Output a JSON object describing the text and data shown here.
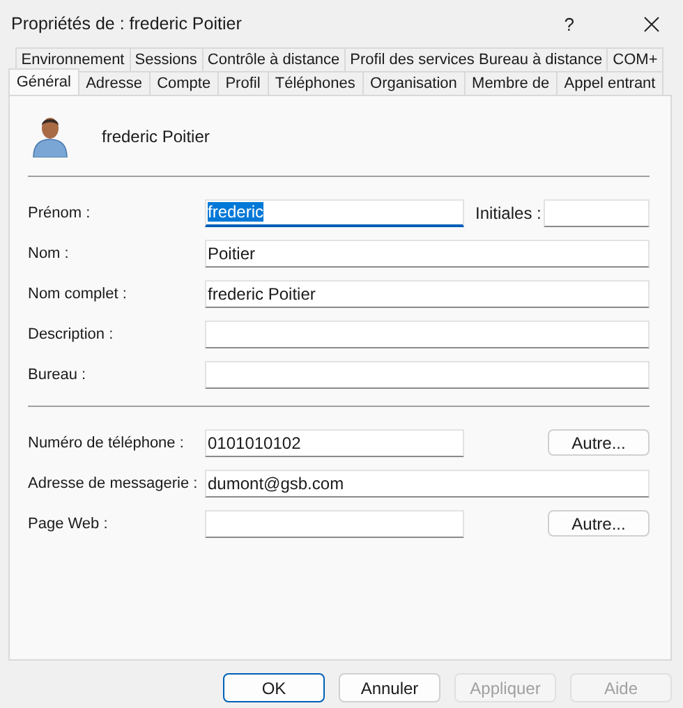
{
  "window": {
    "title": "Propriétés de : frederic Poitier",
    "help": "?"
  },
  "tab_rows": [
    {
      "tabs": [
        {
          "label": "Environnement",
          "selected": false
        },
        {
          "label": "Sessions",
          "selected": false
        },
        {
          "label": "Contrôle à distance",
          "selected": false
        },
        {
          "label": "Profil des services Bureau à distance",
          "selected": false
        },
        {
          "label": "COM+",
          "selected": false
        }
      ]
    },
    {
      "tabs": [
        {
          "label": "Général",
          "selected": true
        },
        {
          "label": "Adresse",
          "selected": false
        },
        {
          "label": "Compte",
          "selected": false
        },
        {
          "label": "Profil",
          "selected": false
        },
        {
          "label": "Téléphones",
          "selected": false
        },
        {
          "label": "Organisation",
          "selected": false
        },
        {
          "label": "Membre de",
          "selected": false
        },
        {
          "label": "Appel entrant",
          "selected": false
        }
      ]
    }
  ],
  "identity": {
    "name": "frederic Poitier"
  },
  "sections": [
    {
      "rows": [
        {
          "label": "Prénom :",
          "value": "frederic",
          "focused": true,
          "extra": {
            "kind": "field",
            "label": "Initiales :"
          }
        },
        {
          "label": "Nom :",
          "value": "Poitier",
          "focused": false
        },
        {
          "label": "Nom complet :",
          "value": "frederic Poitier",
          "focused": false
        },
        {
          "label": "Description :",
          "focused": false
        },
        {
          "label": "Bureau :",
          "focused": false
        }
      ]
    },
    {
      "rows": [
        {
          "label": "Numéro de téléphone :",
          "value": "0101010102",
          "focused": false,
          "extra": {
            "kind": "button",
            "label": "Autre..."
          }
        },
        {
          "label": "Adresse de messagerie :",
          "value": "dumont@gsb.com",
          "focused": false
        },
        {
          "label": "Page Web :",
          "focused": false,
          "extra": {
            "kind": "button",
            "label": "Autre..."
          }
        }
      ]
    }
  ],
  "buttons": [
    {
      "label": "OK",
      "default": true,
      "disabled": false
    },
    {
      "label": "Annuler",
      "default": false,
      "disabled": false
    },
    {
      "label": "Appliquer",
      "default": false,
      "disabled": true
    },
    {
      "label": "Aide",
      "default": false,
      "disabled": true
    }
  ]
}
